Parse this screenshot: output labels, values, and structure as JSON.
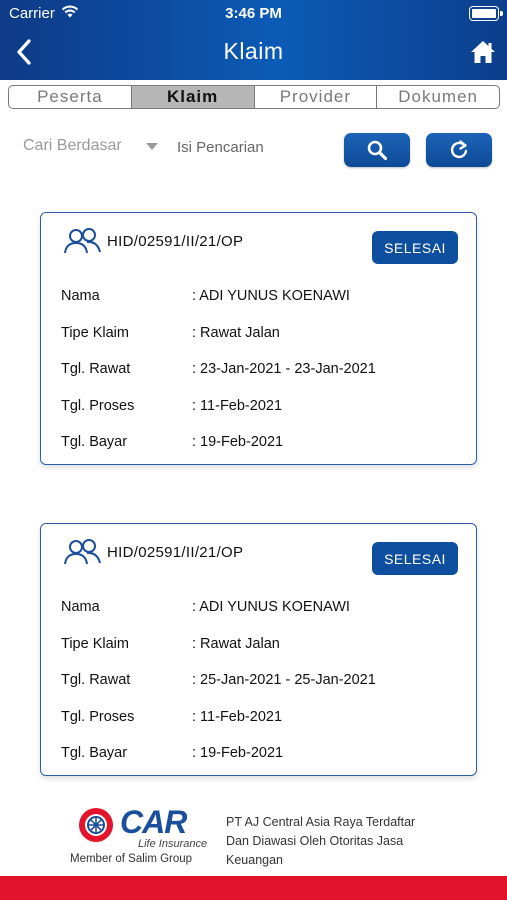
{
  "status_bar": {
    "carrier": "Carrier",
    "time": "3:46 PM"
  },
  "navbar": {
    "title": "Klaim"
  },
  "tabs": [
    {
      "label": "Peserta",
      "active": false
    },
    {
      "label": "Klaim",
      "active": true
    },
    {
      "label": "Provider",
      "active": false
    },
    {
      "label": "Dokumen",
      "active": false
    }
  ],
  "search": {
    "filter_label": "Cari Berdasar",
    "placeholder": "Isi Pencarian",
    "search_icon": "search-icon",
    "refresh_icon": "refresh-icon"
  },
  "claims": [
    {
      "id": "HID/02591/II/21/OP",
      "status": "SELESAI",
      "fields": [
        {
          "label": "Nama",
          "value": ": ADI YUNUS KOENAWI"
        },
        {
          "label": "Tipe Klaim",
          "value": ": Rawat Jalan"
        },
        {
          "label": "Tgl. Rawat",
          "value": ": 23-Jan-2021 - 23-Jan-2021"
        },
        {
          "label": "Tgl. Proses",
          "value": ": 11-Feb-2021"
        },
        {
          "label": "Tgl. Bayar",
          "value": ": 19-Feb-2021"
        }
      ]
    },
    {
      "id": "HID/02591/II/21/OP",
      "status": "SELESAI",
      "fields": [
        {
          "label": "Nama",
          "value": ": ADI YUNUS KOENAWI"
        },
        {
          "label": "Tipe Klaim",
          "value": ": Rawat Jalan"
        },
        {
          "label": "Tgl. Rawat",
          "value": ": 25-Jan-2021 - 25-Jan-2021"
        },
        {
          "label": "Tgl. Proses",
          "value": ": 11-Feb-2021"
        },
        {
          "label": "Tgl. Bayar",
          "value": ": 19-Feb-2021"
        }
      ]
    }
  ],
  "footer": {
    "logo_text": "CAR",
    "logo_sub": "Life Insurance",
    "member": "Member of Salim Group",
    "line1": "PT AJ Central Asia Raya Terdaftar",
    "line2": "Dan Diawasi Oleh Otoritas Jasa",
    "line3": "Keuangan"
  },
  "colors": {
    "header_blue": "#0b5bb6",
    "button_blue": "#0d4f9e",
    "card_border": "#2d5fa6",
    "bottom_red": "#e3132b"
  }
}
